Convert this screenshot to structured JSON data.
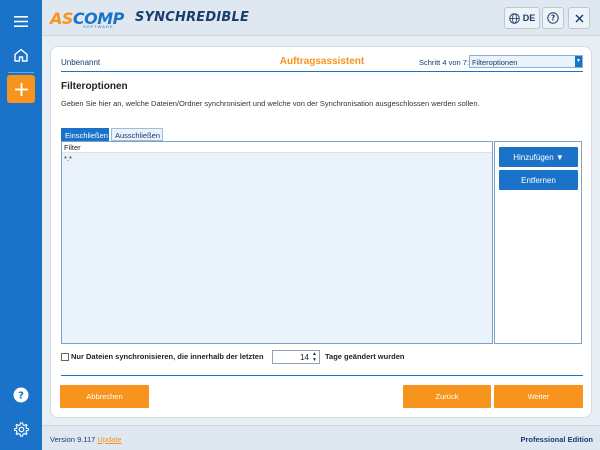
{
  "app": {
    "logo_as": "AS",
    "logo_comp": "COMP",
    "logo_sub": "SOFTWARE",
    "title": "SYNCHREDIBLE",
    "language": "DE",
    "accent_blue": "#1a73c9",
    "accent_orange": "#f7941d"
  },
  "rail": {
    "icons": [
      "menu-icon",
      "home-icon",
      "plus-icon",
      "help-icon",
      "settings-icon"
    ]
  },
  "wizard": {
    "job_name": "Unbenannt",
    "title": "Auftragsassistent",
    "step_label": "Schritt 4 von 7:",
    "step_value": "Filteroptionen"
  },
  "section": {
    "title": "Filteroptionen",
    "description": "Geben Sie hier an, welche Dateien/Ordner synchronisiert und welche von der Synchronisation ausgeschlossen werden sollen."
  },
  "tabs": [
    {
      "label": "Einschließen",
      "active": true
    },
    {
      "label": "Ausschließen",
      "active": false
    }
  ],
  "filter": {
    "header": "Filter",
    "rows": [
      "*.*"
    ]
  },
  "side_buttons": {
    "add": "Hinzufügen ▼",
    "remove": "Entfernen"
  },
  "recent": {
    "checked": false,
    "label_before": "Nur Dateien synchronisieren, die innerhalb der letzten",
    "days": "14",
    "label_after": "Tage geändert wurden"
  },
  "buttons": {
    "cancel": "Abbrechen",
    "back": "Zurück",
    "next": "Weiter"
  },
  "footer": {
    "version": "Version 9.117",
    "update": "Update",
    "edition": "Professional Edition"
  }
}
